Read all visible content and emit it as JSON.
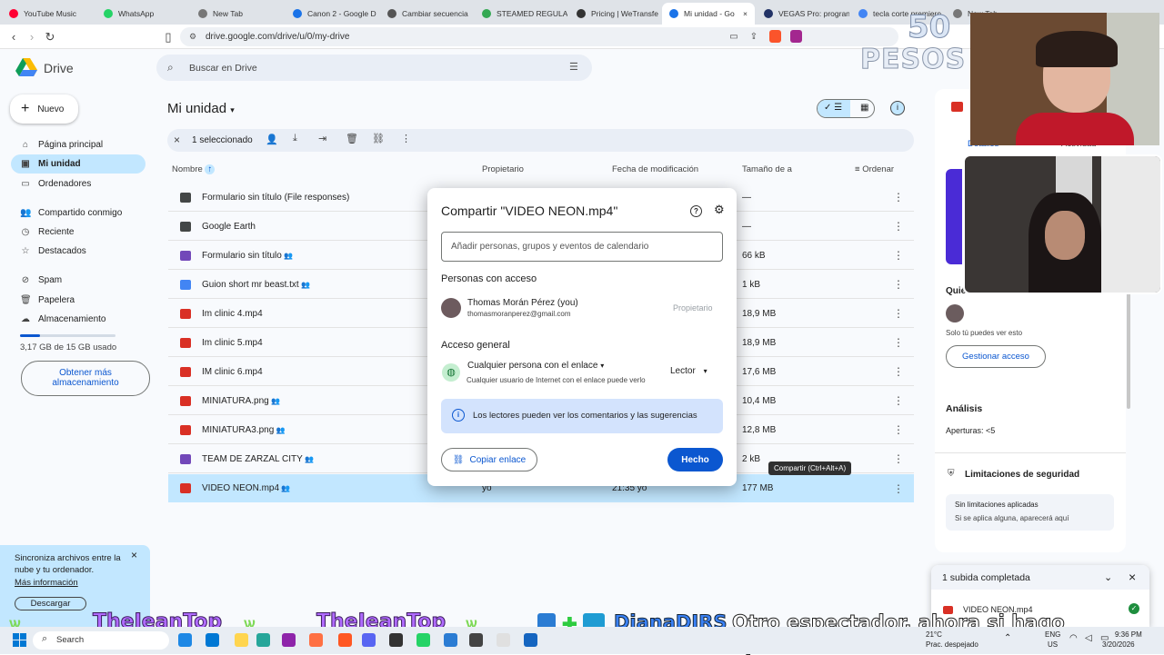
{
  "browser": {
    "tabs": [
      {
        "label": "YouTube Music",
        "color": "#ff0033"
      },
      {
        "label": "WhatsApp",
        "color": "#25d366"
      },
      {
        "label": "New Tab",
        "color": "#777777"
      },
      {
        "label": "Canon 2 - Google D",
        "color": "#1a73e8"
      },
      {
        "label": "Cambiar secuencia",
        "color": "#555555"
      },
      {
        "label": "STEAMED REGULAR",
        "color": "#34a853"
      },
      {
        "label": "Pricing | WeTransfe",
        "color": "#333333"
      },
      {
        "label": "Mi unidad - Go",
        "color": "#1a73e8"
      },
      {
        "label": "VEGAS Pro: progran",
        "color": "#223366"
      },
      {
        "label": "tecla corte premiere",
        "color": "#4285f4"
      },
      {
        "label": "New Tab",
        "color": "#777777"
      }
    ],
    "url": "drive.google.com/drive/u/0/my-drive"
  },
  "drive": {
    "logo_label": "Drive",
    "search_placeholder": "Buscar en Drive",
    "new_button": "Nuevo",
    "nav": [
      {
        "label": "Página principal",
        "icon": "home-icon"
      },
      {
        "label": "Mi unidad",
        "icon": "drive-icon"
      },
      {
        "label": "Ordenadores",
        "icon": "computer-icon"
      },
      {
        "label": "Compartido conmigo",
        "icon": "people-icon"
      },
      {
        "label": "Reciente",
        "icon": "clock-icon"
      },
      {
        "label": "Destacados",
        "icon": "star-icon"
      },
      {
        "label": "Spam",
        "icon": "spam-icon"
      },
      {
        "label": "Papelera",
        "icon": "trash-icon"
      },
      {
        "label": "Almacenamiento",
        "icon": "cloud-icon"
      }
    ],
    "storage_text": "3,17 GB de 15 GB usado",
    "storage_fraction": 0.21,
    "more_storage_button": "Obtener más almacenamiento",
    "page_title": "Mi unidad",
    "selection_text": "1 seleccionado",
    "columns": {
      "name": "Nombre",
      "owner": "Propietario",
      "modified": "Fecha de modificación",
      "size": "Tamaño de a",
      "sort": "Ordenar"
    },
    "files": [
      {
        "name": "Formulario sin título (File responses)",
        "size": "—",
        "type": "folder"
      },
      {
        "name": "Google Earth",
        "size": "—",
        "type": "folder"
      },
      {
        "name": "Formulario sin título",
        "size": "66 kB",
        "type": "form",
        "shared": true
      },
      {
        "name": "Guion short mr beast.txt",
        "size": "1 kB",
        "type": "doc",
        "shared": true
      },
      {
        "name": "Im clinic 4.mp4",
        "size": "18,9 MB",
        "type": "video"
      },
      {
        "name": "Im clinic 5.mp4",
        "size": "18,9 MB",
        "type": "video"
      },
      {
        "name": "IM clinic 6.mp4",
        "size": "17,6 MB",
        "type": "video"
      },
      {
        "name": "MINIATURA.png",
        "size": "10,4 MB",
        "type": "image",
        "shared": true
      },
      {
        "name": "MINIATURA3.png",
        "size": "12,8 MB",
        "type": "image",
        "shared": true
      },
      {
        "name": "TEAM DE ZARZAL CITY",
        "size": "2 kB",
        "type": "form",
        "shared": true
      },
      {
        "name": "VIDEO NEON.mp4",
        "size": "177 MB",
        "type": "video",
        "shared": true,
        "owner": "yo",
        "modified": "21:35 yo",
        "selected": true
      }
    ],
    "tooltip": "Compartir (Ctrl+Alt+A)",
    "sync_banner": {
      "text": "Sincroniza archivos entre la nube y tu ordenador.",
      "link": "Más información",
      "button": "Descargar"
    }
  },
  "details_panel": {
    "tab_details": "Detalles",
    "tab_activity": "Actividad",
    "access_title": "Quién tiene acceso",
    "access_note": "Solo tú puedes ver esto",
    "manage_button": "Gestionar acceso",
    "analysis_title": "Análisis",
    "analysis_value": "Aperturas: <5",
    "security_title": "Limitaciones de seguridad",
    "security_line1": "Sin limitaciones aplicadas",
    "security_line2": "Si se aplica alguna, aparecerá aquí"
  },
  "upload_toast": {
    "title": "1 subida completada",
    "file": "VIDEO NEON.mp4"
  },
  "share_dialog": {
    "title": "Compartir \"VIDEO NEON.mp4\"",
    "input_placeholder": "Añadir personas, grupos y eventos de calendario",
    "people_heading": "Personas con acceso",
    "person_name": "Thomas Morán Pérez (you)",
    "person_email": "thomasmoranperez@gmail.com",
    "person_role": "Propietario",
    "general_heading": "Acceso general",
    "access_option": "Cualquier persona con el enlace",
    "access_desc": "Cualquier usuario de Internet con el enlace puede verlo",
    "role": "Lector",
    "info": "Los lectores pueden ver los comentarios y las sugerencias",
    "copy_button": "Copiar enlace",
    "done_button": "Hecho"
  },
  "stream_overlay": {
    "badge_top": "50",
    "badge_bottom": "PESOS",
    "chat_name1": "TheJeanTop",
    "chat_name2": "TheJeanTop",
    "chat_name3": "DianaDIRS",
    "chat_message": "Otro espectador, ahora si hago apuesta?"
  },
  "taskbar": {
    "search": "Search",
    "weather": "21°C",
    "weather_desc": "Prac. despejado",
    "lang": "ENG",
    "region": "US",
    "time": "9:36 PM",
    "date": "3/20/2026"
  }
}
